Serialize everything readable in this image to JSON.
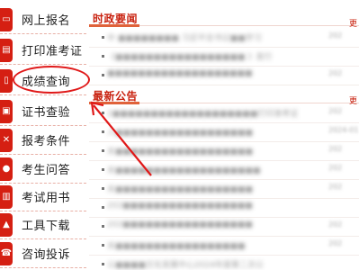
{
  "sidebar": {
    "items": [
      {
        "label": "网上报名",
        "icon": "monitor-icon"
      },
      {
        "label": "打印准考证",
        "icon": "printer-icon"
      },
      {
        "label": "成绩查询",
        "icon": "document-icon"
      },
      {
        "label": "证书查验",
        "icon": "certificate-icon"
      },
      {
        "label": "报考条件",
        "icon": "tools-icon"
      },
      {
        "label": "考生问答",
        "icon": "chat-icon"
      },
      {
        "label": "考试用书",
        "icon": "book-icon"
      },
      {
        "label": "工具下载",
        "icon": "toolbox-icon"
      },
      {
        "label": "咨询投诉",
        "icon": "phone-icon"
      }
    ]
  },
  "sections": {
    "news": {
      "title": "时政要闻",
      "more": "更",
      "rows": [
        {
          "title": "中 ■■■■■■■■ 习近平总书记■■学习",
          "date": "202"
        },
        {
          "title": "《■■■■■■■■■■■■■■■■■ 》发行",
          "date": ""
        },
        {
          "title": "■■■■■■■■■■■■■■■■■■■",
          "date": "202"
        }
      ]
    },
    "notices": {
      "title": "最新公告",
      "more": "更",
      "rows": [
        {
          "title": "2■■■■■■■■■■■■■■■■■■■打印准考证",
          "date": "202"
        },
        {
          "title": "人■■■■■■■■■■■■■■■■■■",
          "date": "2024-01"
        },
        {
          "title": "关■■■■■■■■■■■■■■■■■■",
          "date": "202"
        },
        {
          "title": "关■■■■■■■■■■■■■■■■■■■",
          "date": "202"
        },
        {
          "title": "关■■■■■■■■■■■■■■■■■■",
          "date": "202"
        },
        {
          "title": "202■■■■■■■■■■■■■■■■■",
          "date": ""
        },
        {
          "title": "202■■■■■■■■■■■■■■■■■",
          "date": "202"
        },
        {
          "title": "关■■■■■■■■■■■■■■■■■",
          "date": "202"
        },
        {
          "title": "公■■■■文化发展中心2024年度第二次公",
          "date": ""
        }
      ]
    }
  },
  "annotation": {
    "color": "#e01818"
  }
}
